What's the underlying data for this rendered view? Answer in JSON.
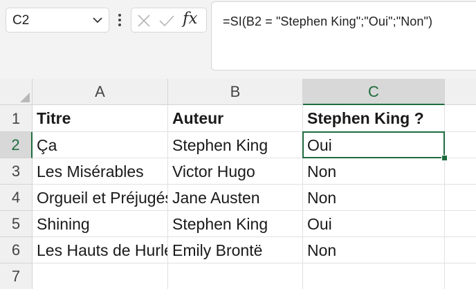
{
  "namebox": {
    "value": "C2"
  },
  "formula_bar": {
    "cancel_icon": "close-icon",
    "enter_icon": "checkmark-icon",
    "insert_function_label": "fx",
    "formula": "=SI(B2 = \"Stephen King\";\"Oui\";\"Non\")"
  },
  "columns": [
    {
      "label": "A"
    },
    {
      "label": "B"
    },
    {
      "label": "C"
    }
  ],
  "rows": [
    {
      "label": "1",
      "cells": [
        "Titre",
        "Auteur",
        "Stephen King ?"
      ]
    },
    {
      "label": "2",
      "cells": [
        "Ça",
        "Stephen King",
        "Oui"
      ]
    },
    {
      "label": "3",
      "cells": [
        "Les Misérables",
        "Victor Hugo",
        "Non"
      ]
    },
    {
      "label": "4",
      "cells": [
        "Orgueil et Préjugés",
        "Jane Austen",
        "Non"
      ]
    },
    {
      "label": "5",
      "cells": [
        "Shining",
        "Stephen King",
        "Oui"
      ]
    },
    {
      "label": "6",
      "cells": [
        "Les Hauts de Hurlevent",
        "Emily Brontë",
        "Non"
      ]
    },
    {
      "label": "7",
      "cells": [
        "",
        "",
        ""
      ]
    }
  ],
  "selection": {
    "active_cell": "C2"
  },
  "colors": {
    "accent": "#1e6b3e",
    "header_bg": "#f0f0f0",
    "grid_line": "#e1e1e1"
  }
}
